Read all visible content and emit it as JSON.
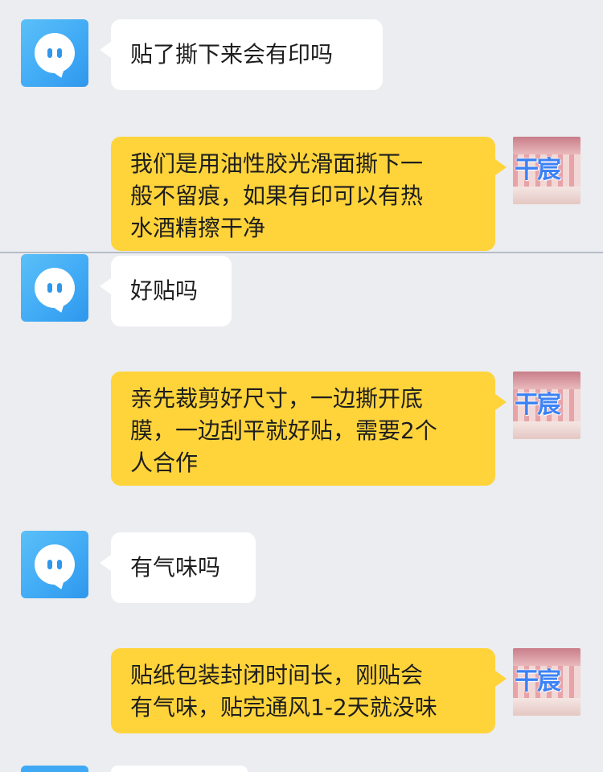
{
  "colors": {
    "background": "#EBEDF0",
    "incoming_bubble": "#FFFFFF",
    "outgoing_bubble": "#FFD43B",
    "customer_avatar": "#3FA9F5",
    "divider": "#B7BDC6"
  },
  "icons": {
    "customer_avatar": "chat-bubble-face-icon",
    "seller_avatar": "shop-photo-avatar-icon"
  },
  "seller_avatar_logo": "干宸",
  "messages": [
    {
      "sender": "customer",
      "lines": [
        "贴了撕下来会有印吗"
      ]
    },
    {
      "sender": "seller",
      "lines": [
        "我们是用油性胶光滑面撕下一",
        "般不留痕，如果有印可以有热",
        "水酒精擦干净"
      ]
    },
    {
      "sender": "customer",
      "lines": [
        "好贴吗"
      ]
    },
    {
      "sender": "seller",
      "lines": [
        "亲先裁剪好尺寸，一边撕开底",
        "膜，一边刮平就好贴，需要2个",
        "人合作"
      ]
    },
    {
      "sender": "customer",
      "lines": [
        "有气味吗"
      ]
    },
    {
      "sender": "seller",
      "lines": [
        "贴纸包装封闭时间长，刚贴会",
        "有气味，贴完通风1-2天就没味"
      ]
    }
  ]
}
